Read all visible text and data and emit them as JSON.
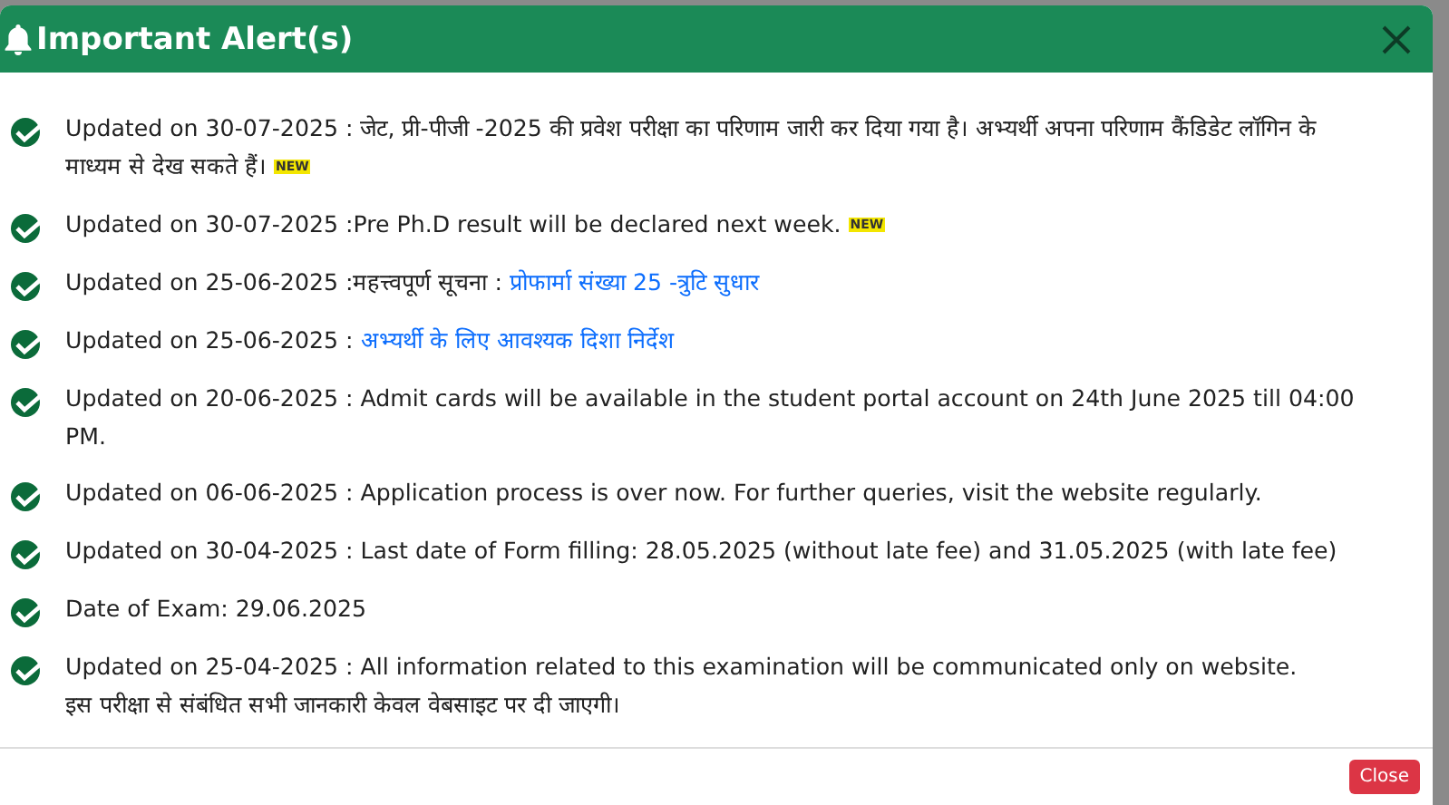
{
  "dialog": {
    "title": "Important Alert(s)",
    "close_label": "Close"
  },
  "alerts": [
    {
      "text": "Updated on 30-07-2025 : जेट, प्री-पीजी -2025 की प्रवेश परीक्षा का परिणाम जारी कर दिया गया है। अभ्यर्थी अपना परिणाम कैंडिडेट लॉगिन के माध्यम से देख सकते हैं।",
      "new": true,
      "badge": "NEW"
    },
    {
      "text": "Updated on 30-07-2025 :Pre Ph.D result will be declared next week.",
      "new": true,
      "badge": "NEW"
    },
    {
      "text": "Updated on 25-06-2025 :महत्त्वपूर्ण सूचना :",
      "link": "प्रोफार्मा संख्या 25 -त्रुटि सुधार",
      "new": false
    },
    {
      "text": "Updated on 25-06-2025 :",
      "link": "अभ्यर्थी के लिए आवश्यक दिशा निर्देश",
      "new": false
    },
    {
      "text": "Updated on 20-06-2025 : Admit cards will be available in the student portal account on 24th June 2025 till 04:00 PM.",
      "new": false
    },
    {
      "text": "Updated on 06-06-2025 : Application process is over now. For further queries, visit the website regularly.",
      "new": false
    },
    {
      "text": "Updated on 30-04-2025 : Last date of Form filling: 28.05.2025 (without late fee) and 31.05.2025 (with late fee)",
      "new": false
    },
    {
      "text": "Date of Exam: 29.06.2025",
      "new": false
    },
    {
      "text": "Updated on 25-04-2025 : All information related to this examination will be communicated only on website.",
      "note": "इस परीक्षा से संबंधित सभी जानकारी केवल वेबसाइट पर दी जाएगी।",
      "new": false
    }
  ]
}
